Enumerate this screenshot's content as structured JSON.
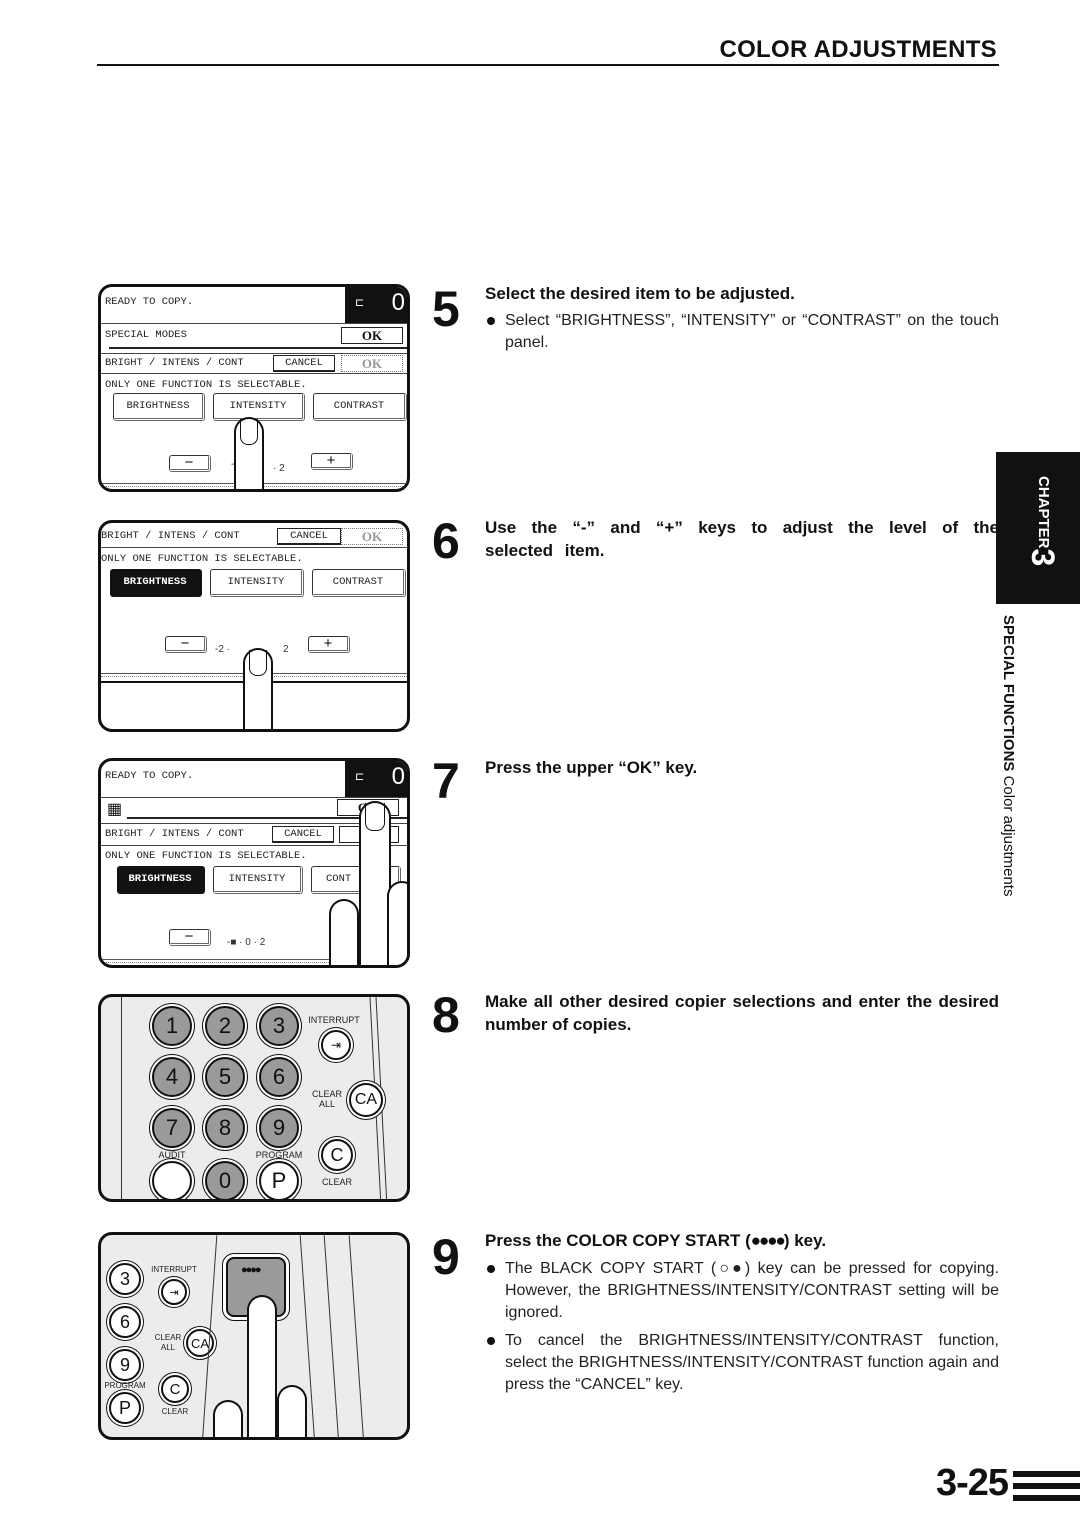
{
  "header": {
    "title": "COLOR ADJUSTMENTS"
  },
  "side_tab": {
    "chapter_word": "CHAPTER",
    "chapter_number": "3",
    "section_bold": "SPECIAL FUNCTIONS",
    "section_regular": "Color adjustments"
  },
  "page_number": "3-25",
  "panels": {
    "p1": {
      "status": "READY TO COPY.",
      "copy_count": "0",
      "special_modes": "SPECIAL MODES",
      "ok_upper": "OK",
      "sub_title": "BRIGHT / INTENS / CONT",
      "cancel": "CANCEL",
      "ok_lower": "OK",
      "note": "ONLY ONE FUNCTION IS SELECTABLE.",
      "buttons": [
        "BRIGHTNESS",
        "INTENSITY",
        "CONTRAST"
      ],
      "minus": "−",
      "plus": "+",
      "scale_left": "-",
      "scale_right": "· 2"
    },
    "p2": {
      "sub_title": "BRIGHT / INTENS / CONT",
      "cancel": "CANCEL",
      "ok_lower": "OK",
      "note": "ONLY ONE FUNCTION IS SELECTABLE.",
      "buttons": [
        "BRIGHTNESS",
        "INTENSITY",
        "CONTRAST"
      ],
      "selected": "BRIGHTNESS",
      "minus": "−",
      "plus": "+",
      "scale_left": "-2 ·",
      "scale_right": "2"
    },
    "p3": {
      "status": "READY TO COPY.",
      "copy_count": "0",
      "ok_upper": "OK",
      "sub_title": "BRIGHT / INTENS / CONT",
      "cancel": "CANCEL",
      "note": "ONLY ONE FUNCTION IS SELECTABLE.",
      "buttons": [
        "BRIGHTNESS",
        "INTENSITY",
        "CONT"
      ],
      "selected": "BRIGHTNESS",
      "minus": "−",
      "scale": "-■ · 0 · 2"
    },
    "keypad": {
      "keys": [
        "1",
        "2",
        "3",
        "4",
        "5",
        "6",
        "7",
        "8",
        "9",
        "",
        "0",
        "P"
      ],
      "interrupt": "INTERRUPT",
      "clear_all_label": "CLEAR\nALL",
      "ca": "CA",
      "c": "C",
      "clear": "CLEAR",
      "audit": "AUDIT",
      "program": "PROGRAM"
    },
    "p5": {
      "keys": [
        "3",
        "6",
        "9",
        "P"
      ],
      "interrupt": "INTERRUPT",
      "clear_all_label": "CLEAR\nALL",
      "ca": "CA",
      "c": "C",
      "clear": "CLEAR",
      "program": "PROGRAM",
      "color_start_symbol": "●●●●"
    }
  },
  "steps": [
    {
      "number": "5",
      "heading": "Select the desired item to be adjusted.",
      "bullets": [
        "Select “BRIGHTNESS”, “INTENSITY” or “CONTRAST” on the touch panel."
      ]
    },
    {
      "number": "6",
      "heading": "Use the “-” and “+” keys to adjust the level of the selected item.",
      "bullets": []
    },
    {
      "number": "7",
      "heading": "Press the upper “OK” key.",
      "bullets": []
    },
    {
      "number": "8",
      "heading": "Make all other desired copier selections and enter the desired number of copies.",
      "bullets": []
    },
    {
      "number": "9",
      "heading_pre": "Press the COLOR COPY START (",
      "heading_symbol": "●●●●",
      "heading_post": ") key.",
      "bullets": [
        {
          "pre": "The BLACK COPY START (",
          "symbol": "○●",
          "post": ") key can be pressed for copying. However, the BRIGHTNESS/INTENSITY/CONTRAST setting will be ignored."
        },
        {
          "text": "To cancel the BRIGHTNESS/INTENSITY/CONTRAST function, select the BRIGHTNESS/INTENSITY/CONTRAST function again and press the “CANCEL” key."
        }
      ]
    }
  ]
}
